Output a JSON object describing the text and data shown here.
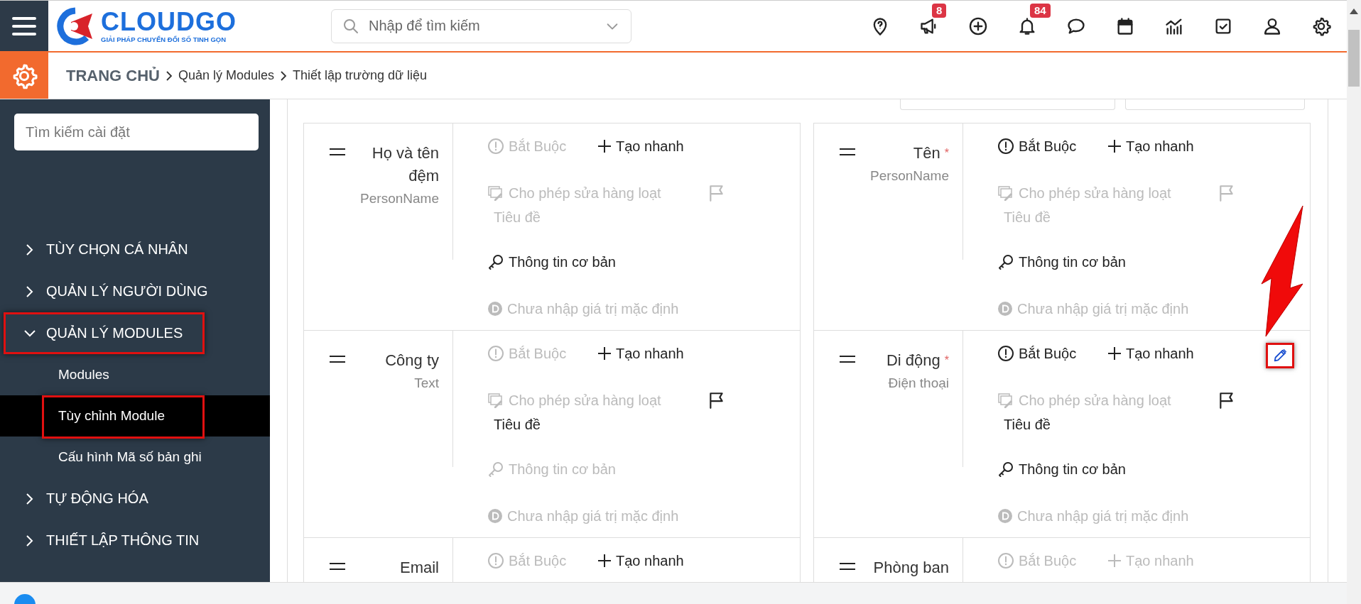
{
  "header": {
    "logo": {
      "name": "CLOUDGO",
      "tagline": "GIẢI PHÁP CHUYỂN ĐỔI SỐ TINH GỌN"
    },
    "search": {
      "placeholder": "Nhập để tìm kiếm"
    },
    "icons": [
      {
        "kind": "pin"
      },
      {
        "kind": "megaphone",
        "badge": "8"
      },
      {
        "kind": "plus"
      },
      {
        "kind": "bell",
        "badge": "84"
      },
      {
        "kind": "chat"
      },
      {
        "kind": "calendar"
      },
      {
        "kind": "chart"
      },
      {
        "kind": "task"
      },
      {
        "kind": "user"
      },
      {
        "kind": "gear"
      }
    ]
  },
  "breadcrumb": [
    "TRANG CHỦ",
    "Quản lý Modules",
    "Thiết lập trường dữ liệu"
  ],
  "sidebar": {
    "search": {
      "placeholder": "Tìm kiếm cài đặt"
    },
    "items": [
      {
        "label": "TÙY CHỌN CÁ NHÂN",
        "expanded": false,
        "annotated": false
      },
      {
        "label": "QUẢN LÝ NGƯỜI DÙNG",
        "expanded": false,
        "annotated": false
      },
      {
        "label": "QUẢN LÝ MODULES",
        "expanded": true,
        "annotated": true,
        "children": [
          {
            "label": "Modules",
            "selected": false,
            "annotated": false
          },
          {
            "label": "Tùy chỉnh Module",
            "selected": true,
            "annotated": true
          },
          {
            "label": "Cấu hình Mã số bản ghi",
            "selected": false,
            "annotated": false
          }
        ]
      },
      {
        "label": "TỰ ĐỘNG HÓA",
        "expanded": false,
        "annotated": false
      },
      {
        "label": "THIẾT LẬP THÔNG TIN",
        "expanded": false,
        "annotated": false
      }
    ]
  },
  "fields": [
    {
      "name": "Họ và tên đệm",
      "type": "PersonName",
      "options": [
        {
          "kind": "required",
          "label": "Bắt Buộc",
          "on": false
        },
        {
          "kind": "quick_create",
          "label": "Tạo nhanh",
          "on": true
        },
        {
          "kind": "mass_edit",
          "label": "Cho phép sửa hàng loạt",
          "on": false
        },
        {
          "kind": "title",
          "label": "Tiêu đề",
          "on": false
        },
        {
          "kind": "basic_info",
          "label": "Thông tin cơ bản",
          "on": true
        },
        {
          "kind": "default",
          "label": "Chưa nhập giá trị mặc định",
          "on": false
        }
      ]
    },
    {
      "name": "Tên",
      "required_mark": "*",
      "type": "PersonName",
      "options": [
        {
          "kind": "required",
          "label": "Bắt Buộc",
          "on": true
        },
        {
          "kind": "quick_create",
          "label": "Tạo nhanh",
          "on": true
        },
        {
          "kind": "mass_edit",
          "label": "Cho phép sửa hàng loạt",
          "on": false
        },
        {
          "kind": "title",
          "label": "Tiêu đề",
          "on": false
        },
        {
          "kind": "basic_info",
          "label": "Thông tin cơ bản",
          "on": true
        },
        {
          "kind": "default",
          "label": "Chưa nhập giá trị mặc định",
          "on": false
        }
      ]
    },
    {
      "name": "Công ty",
      "type": "Text",
      "options": [
        {
          "kind": "required",
          "label": "Bắt Buộc",
          "on": false
        },
        {
          "kind": "quick_create",
          "label": "Tạo nhanh",
          "on": true
        },
        {
          "kind": "mass_edit",
          "label": "Cho phép sửa hàng loạt",
          "on": false
        },
        {
          "kind": "title",
          "label": "Tiêu đề",
          "on": true
        },
        {
          "kind": "basic_info",
          "label": "Thông tin cơ bản",
          "on": false
        },
        {
          "kind": "default",
          "label": "Chưa nhập giá trị mặc định",
          "on": false
        }
      ]
    },
    {
      "name": "Di động",
      "required_mark": "*",
      "type": "Điện thoại",
      "edit": {
        "annotated": true
      },
      "options": [
        {
          "kind": "required",
          "label": "Bắt Buộc",
          "on": true
        },
        {
          "kind": "quick_create",
          "label": "Tạo nhanh",
          "on": true
        },
        {
          "kind": "mass_edit",
          "label": "Cho phép sửa hàng loạt",
          "on": false
        },
        {
          "kind": "title",
          "label": "Tiêu đề",
          "on": true
        },
        {
          "kind": "basic_info",
          "label": "Thông tin cơ bản",
          "on": true
        },
        {
          "kind": "default",
          "label": "Chưa nhập giá trị mặc định",
          "on": false
        }
      ]
    },
    {
      "name": "Email",
      "options": [
        {
          "kind": "required",
          "label": "Bắt Buộc",
          "on": false
        },
        {
          "kind": "quick_create",
          "label": "Tạo nhanh",
          "on": true
        }
      ]
    },
    {
      "name": "Phòng ban",
      "options": [
        {
          "kind": "required",
          "label": "Bắt Buộc",
          "on": false
        },
        {
          "kind": "quick_create",
          "label": "Tạo nhanh",
          "on": false
        }
      ]
    }
  ]
}
